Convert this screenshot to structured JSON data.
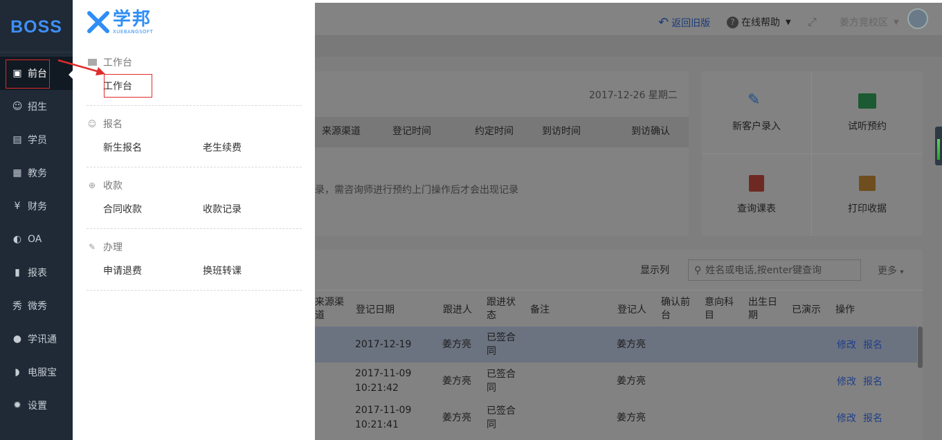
{
  "sidebar": {
    "brand": "BOSS",
    "items": [
      {
        "label": "前台",
        "icon": "calendar-icon",
        "glyph": "▣"
      },
      {
        "label": "招生",
        "icon": "user-add-icon",
        "glyph": "☺"
      },
      {
        "label": "学员",
        "icon": "id-card-icon",
        "glyph": "▤"
      },
      {
        "label": "教务",
        "icon": "book-icon",
        "glyph": "▦"
      },
      {
        "label": "财务",
        "icon": "yen-icon",
        "glyph": "¥"
      },
      {
        "label": "OA",
        "icon": "chat-icon",
        "glyph": "◐"
      },
      {
        "label": "报表",
        "icon": "bar-chart-icon",
        "glyph": "▮"
      },
      {
        "label": "微秀",
        "icon": "xiu-icon",
        "glyph": "秀"
      },
      {
        "label": "学讯通",
        "icon": "location-pin-icon",
        "glyph": "●"
      },
      {
        "label": "电服宝",
        "icon": "phone-icon",
        "glyph": "◗"
      },
      {
        "label": "设置",
        "icon": "gear-icon",
        "glyph": "✹"
      }
    ]
  },
  "flyout": {
    "logo_cn": "学邦",
    "logo_en": "XUEBANGSOFT",
    "sections": [
      {
        "title": "工作台",
        "icon": "monitor-icon",
        "links": [
          "工作台"
        ]
      },
      {
        "title": "报名",
        "icon": "user-add-icon",
        "links": [
          "新生报名",
          "老生续费"
        ]
      },
      {
        "title": "收款",
        "icon": "money-icon",
        "links": [
          "合同收款",
          "收款记录"
        ]
      },
      {
        "title": "办理",
        "icon": "pencil-icon",
        "links": [
          "申请退费",
          "换班转课"
        ]
      }
    ]
  },
  "header": {
    "back_old": "返回旧版",
    "help": "在线帮助",
    "campus": "姜方竞校区"
  },
  "panel1": {
    "date": "2017-12-26 星期二",
    "columns": [
      "来源渠道",
      "登记时间",
      "约定时间",
      "到访时间",
      "到访确认"
    ],
    "empty_text": "录，需咨询师进行预约上门操作后才会出现记录"
  },
  "quick_actions": [
    "新客户录入",
    "试听预约",
    "查询课表",
    "打印收据"
  ],
  "list": {
    "show_columns": "显示列",
    "search_placeholder": "姓名或电话,按enter键查询",
    "more": "更多",
    "headers": [
      "来源渠道",
      "登记日期",
      "跟进人",
      "跟进状态",
      "备注",
      "登记人",
      "确认前台",
      "意向科目",
      "出生日期",
      "已演示",
      "操作"
    ],
    "rows": [
      {
        "date": "2017-12-19",
        "time": "",
        "follower": "姜方亮",
        "status": "已签合同",
        "registrar": "姜方亮",
        "edit": "修改",
        "enroll": "报名"
      },
      {
        "date": "2017-11-09",
        "time": "10:21:42",
        "follower": "姜方亮",
        "status": "已签合同",
        "registrar": "姜方亮",
        "edit": "修改",
        "enroll": "报名"
      },
      {
        "date": "2017-11-09",
        "time": "10:21:41",
        "follower": "姜方亮",
        "status": "已签合同",
        "registrar": "姜方亮",
        "edit": "修改",
        "enroll": "报名"
      }
    ]
  },
  "colors": {
    "sidebar": "#1f2a36",
    "brand_blue": "#2f8ef5",
    "highlight_red": "#e02b2b",
    "overlay": "#7e7e7e"
  }
}
